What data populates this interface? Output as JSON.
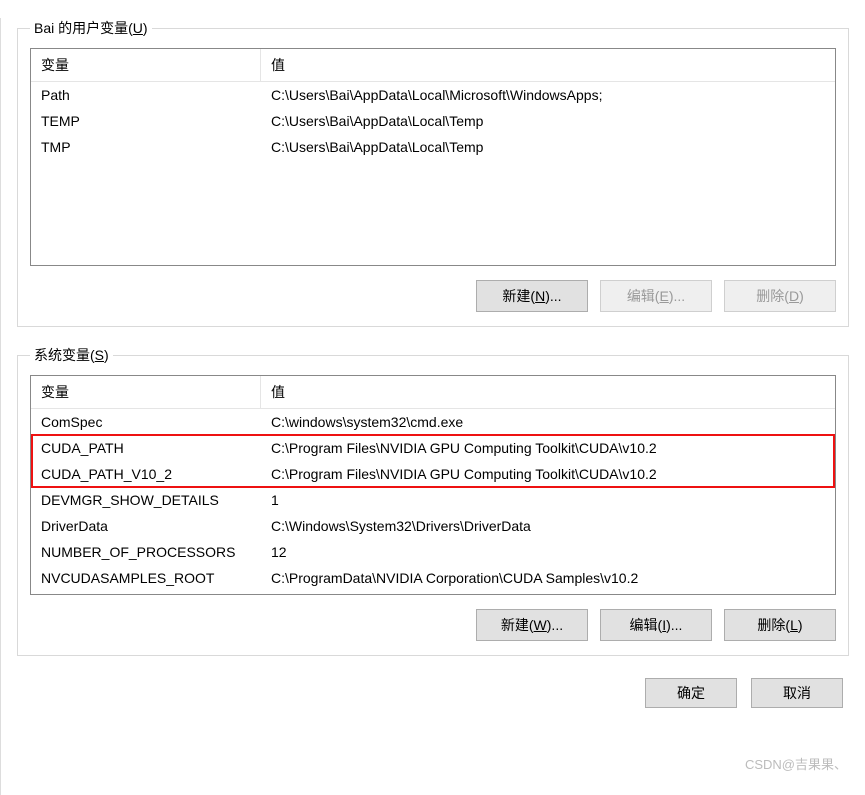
{
  "user_vars": {
    "legend_prefix": "Bai 的用户变量(",
    "legend_key": "U",
    "legend_suffix": ")",
    "columns": {
      "name": "变量",
      "value": "值"
    },
    "rows": [
      {
        "name": "Path",
        "value": "C:\\Users\\Bai\\AppData\\Local\\Microsoft\\WindowsApps;"
      },
      {
        "name": "TEMP",
        "value": "C:\\Users\\Bai\\AppData\\Local\\Temp"
      },
      {
        "name": "TMP",
        "value": "C:\\Users\\Bai\\AppData\\Local\\Temp"
      }
    ],
    "buttons": {
      "new": {
        "prefix": "新建(",
        "key": "N",
        "suffix": ")..."
      },
      "edit": {
        "prefix": "编辑(",
        "key": "E",
        "suffix": ")..."
      },
      "delete": {
        "prefix": "删除(",
        "key": "D",
        "suffix": ")"
      }
    }
  },
  "sys_vars": {
    "legend_prefix": "系统变量(",
    "legend_key": "S",
    "legend_suffix": ")",
    "columns": {
      "name": "变量",
      "value": "值"
    },
    "rows": [
      {
        "name": "ComSpec",
        "value": "C:\\windows\\system32\\cmd.exe"
      },
      {
        "name": "CUDA_PATH",
        "value": "C:\\Program Files\\NVIDIA GPU Computing Toolkit\\CUDA\\v10.2"
      },
      {
        "name": "CUDA_PATH_V10_2",
        "value": "C:\\Program Files\\NVIDIA GPU Computing Toolkit\\CUDA\\v10.2"
      },
      {
        "name": "DEVMGR_SHOW_DETAILS",
        "value": "1"
      },
      {
        "name": "DriverData",
        "value": "C:\\Windows\\System32\\Drivers\\DriverData"
      },
      {
        "name": "NUMBER_OF_PROCESSORS",
        "value": "12"
      },
      {
        "name": "NVCUDASAMPLES_ROOT",
        "value": "C:\\ProgramData\\NVIDIA Corporation\\CUDA Samples\\v10.2"
      }
    ],
    "buttons": {
      "new": {
        "prefix": "新建(",
        "key": "W",
        "suffix": ")..."
      },
      "edit": {
        "prefix": "编辑(",
        "key": "I",
        "suffix": ")..."
      },
      "delete": {
        "prefix": "删除(",
        "key": "L",
        "suffix": ")"
      }
    },
    "highlight_rows": [
      1,
      2
    ]
  },
  "dialog_buttons": {
    "ok": "确定",
    "cancel": "取消"
  },
  "watermark": "CSDN@吉果果、"
}
